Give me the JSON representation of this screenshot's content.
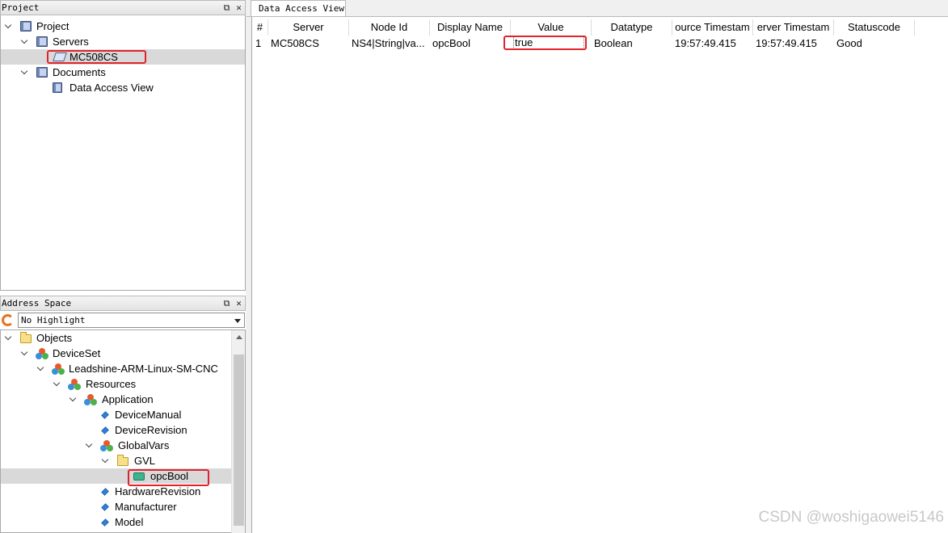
{
  "project_pane": {
    "title": "Project",
    "items": [
      {
        "label": "Project"
      },
      {
        "label": "Servers"
      },
      {
        "label": "MC508CS"
      },
      {
        "label": "Documents"
      },
      {
        "label": "Data Access View"
      }
    ]
  },
  "address_pane": {
    "title": "Address Space",
    "highlight_select": "No Highlight",
    "items": [
      {
        "label": "Objects"
      },
      {
        "label": "DeviceSet"
      },
      {
        "label": "Leadshine-ARM-Linux-SM-CNC"
      },
      {
        "label": "Resources"
      },
      {
        "label": "Application"
      },
      {
        "label": "DeviceManual"
      },
      {
        "label": "DeviceRevision"
      },
      {
        "label": "GlobalVars"
      },
      {
        "label": "GVL"
      },
      {
        "label": "opcBool"
      },
      {
        "label": "HardwareRevision"
      },
      {
        "label": "Manufacturer"
      },
      {
        "label": "Model"
      }
    ]
  },
  "pane_buttons": {
    "float": "⧉",
    "close": "✕"
  },
  "data_view": {
    "tab": "Data Access View",
    "columns": [
      "#",
      "Server",
      "Node Id",
      "Display Name",
      "Value",
      "Datatype",
      "ource Timestam",
      "erver Timestam",
      "Statuscode"
    ],
    "rows": [
      [
        "1",
        "MC508CS",
        "NS4|String|va...",
        "opcBool",
        "true",
        "Boolean",
        "19:57:49.415",
        "19:57:49.415",
        "Good"
      ]
    ]
  },
  "watermark": "CSDN @woshigaowei5146",
  "colors": {
    "highlight_box": "#e0242b",
    "selection": "#d9d9d9"
  }
}
